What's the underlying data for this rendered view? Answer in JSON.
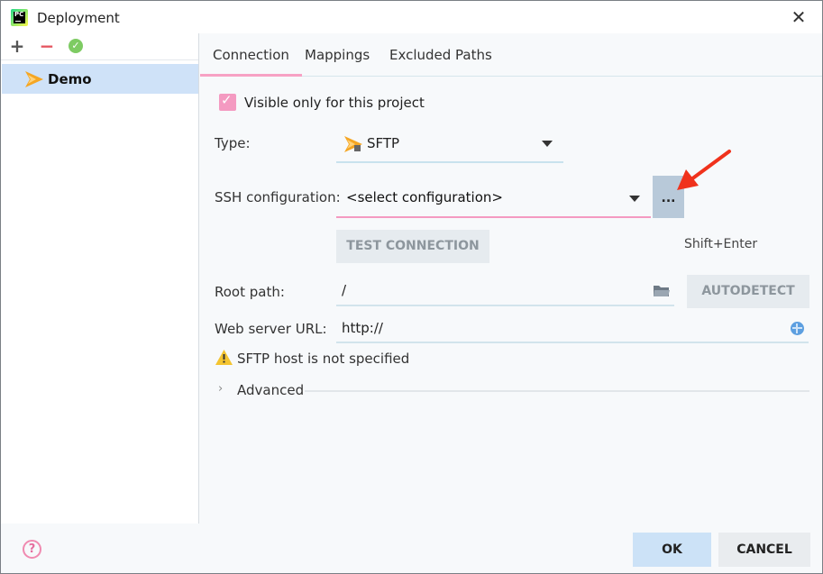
{
  "window": {
    "title": "Deployment",
    "app_icon": "pycharm-logo",
    "close_icon": "close-icon"
  },
  "sidebar": {
    "toolbar": {
      "add_icon": "plus-icon",
      "remove_icon": "minus-icon",
      "default_icon": "check-circle-icon"
    },
    "servers": [
      {
        "label": "Demo",
        "icon": "sftp-server-icon",
        "selected": true
      }
    ]
  },
  "tabs": [
    {
      "label": "Connection",
      "active": true
    },
    {
      "label": "Mappings",
      "active": false
    },
    {
      "label": "Excluded Paths",
      "active": false
    }
  ],
  "connection": {
    "visible_only_label": "Visible only for this project",
    "visible_only_checked": true,
    "type_label": "Type:",
    "type_value": "SFTP",
    "ssh_label": "SSH configuration:",
    "ssh_value": "<select configuration>",
    "browse_label": "...",
    "test_button": "TEST CONNECTION",
    "shortcut_hint": "Shift+Enter",
    "root_label": "Root path:",
    "root_value": "/",
    "autodetect_button": "AUTODETECT",
    "url_label": "Web server URL:",
    "url_value": "http://",
    "warning_text": "SFTP host is not specified",
    "advanced_label": "Advanced"
  },
  "footer": {
    "help_label": "?",
    "ok_button": "OK",
    "cancel_button": "CANCEL"
  },
  "colors": {
    "accent_pink": "#f49ac1",
    "selection_blue": "#cfe2f8",
    "annotation_red": "#f0321c"
  }
}
